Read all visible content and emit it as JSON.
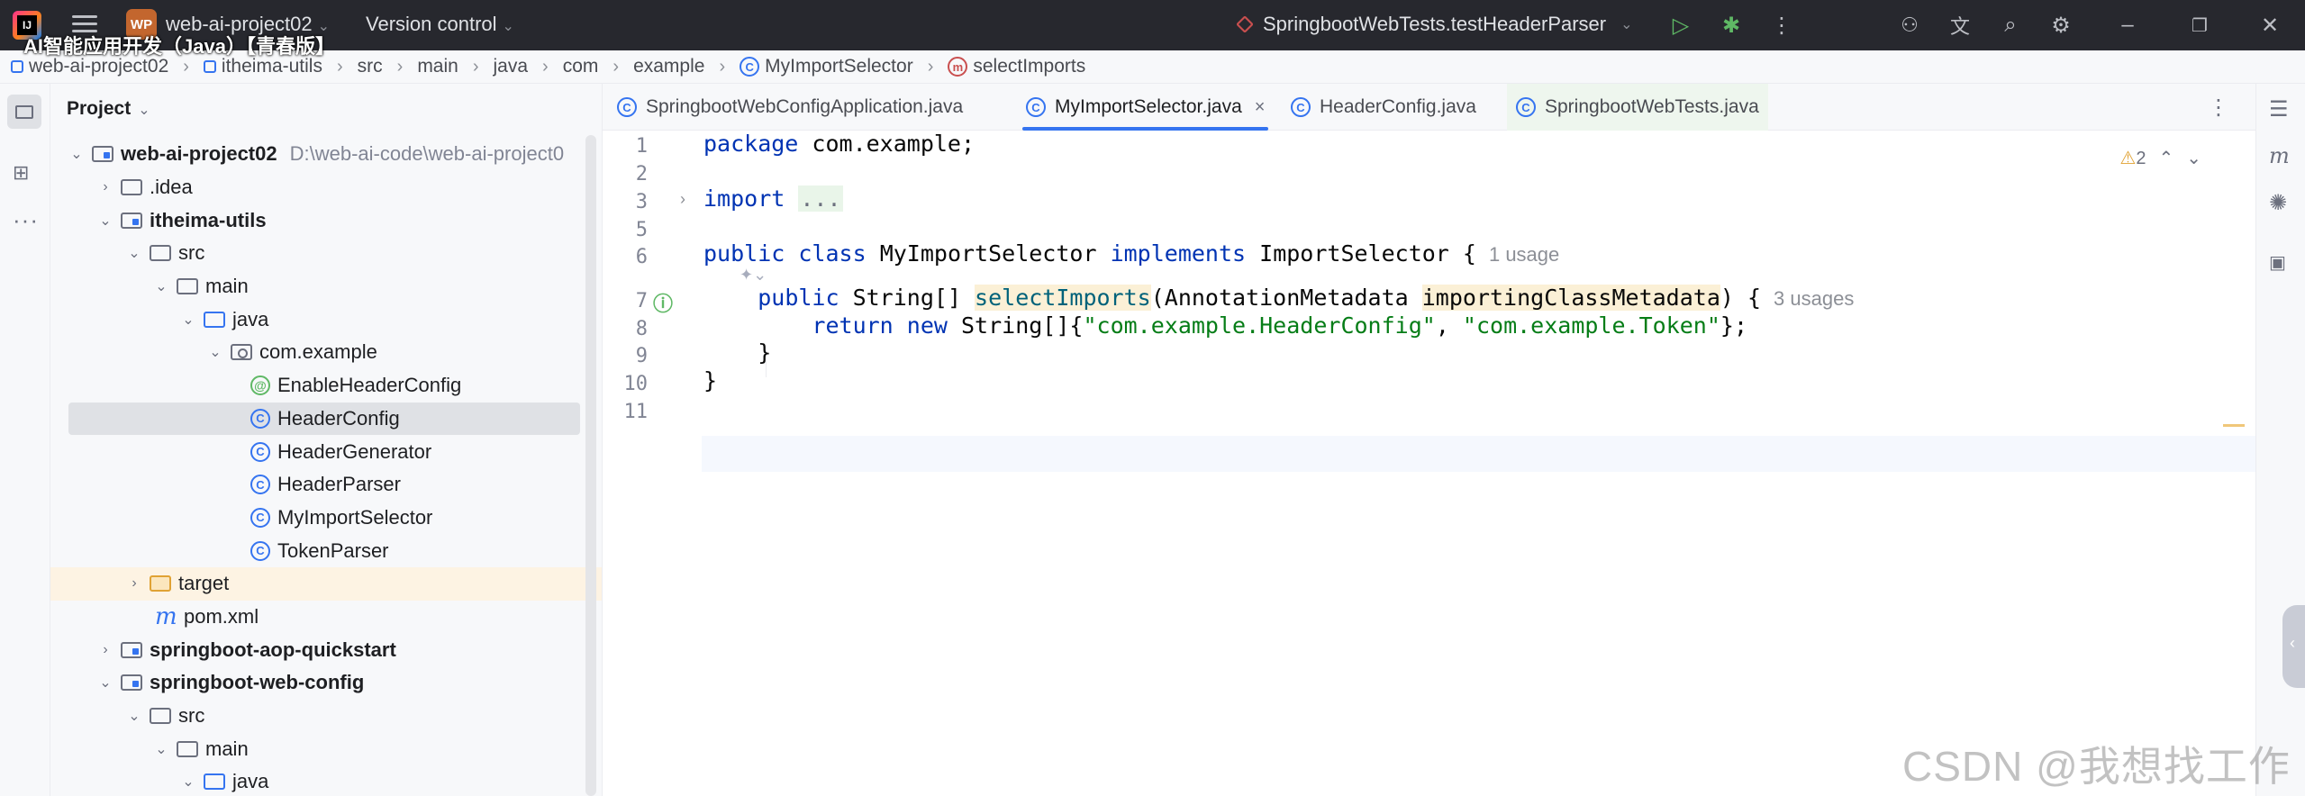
{
  "window": {
    "project_badge": "WP",
    "project_name": "web-ai-project02",
    "version_control": "Version control",
    "run_config": "SpringbootWebTests.testHeaderParser",
    "video_title": "AI智能应用开发（Java）【青春版】"
  },
  "breadcrumb": [
    "web-ai-project02",
    "itheima-utils",
    "src",
    "main",
    "java",
    "com",
    "example",
    "MyImportSelector",
    "selectImports"
  ],
  "project_panel": {
    "title": "Project",
    "root_name": "web-ai-project02",
    "root_path": "D:\\web-ai-code\\web-ai-project0",
    "items": [
      {
        "label": "web-ai-project02"
      },
      {
        "label": ".idea"
      },
      {
        "label": "itheima-utils"
      },
      {
        "label": "src"
      },
      {
        "label": "main"
      },
      {
        "label": "java"
      },
      {
        "label": "com.example"
      },
      {
        "label": "EnableHeaderConfig"
      },
      {
        "label": "HeaderConfig"
      },
      {
        "label": "HeaderGenerator"
      },
      {
        "label": "HeaderParser"
      },
      {
        "label": "MyImportSelector"
      },
      {
        "label": "TokenParser"
      },
      {
        "label": "target"
      },
      {
        "label": "pom.xml"
      },
      {
        "label": "springboot-aop-quickstart"
      },
      {
        "label": "springboot-web-config"
      },
      {
        "label": "src"
      },
      {
        "label": "main"
      },
      {
        "label": "java"
      }
    ]
  },
  "tabs": [
    {
      "label": "SpringbootWebConfigApplication.java"
    },
    {
      "label": "MyImportSelector.java"
    },
    {
      "label": "HeaderConfig.java"
    },
    {
      "label": "SpringbootWebTests.java"
    }
  ],
  "editor": {
    "warning_count": "2",
    "line_numbers": [
      "1",
      "2",
      "3",
      "5",
      "6",
      "7",
      "8",
      "9",
      "10",
      "11"
    ],
    "code": {
      "l1_kw": "package",
      "l1_rest": " com.example;",
      "l3_kw": "import",
      "l3_fold": "...",
      "l6_kw1": "public",
      "l6_kw2": "class",
      "l6_name": " MyImportSelector ",
      "l6_kw3": "implements",
      "l6_rest": " ImportSelector {",
      "l6_hint": "1 usage",
      "l7_kw": "public",
      "l7_type": " String[] ",
      "l7_fn": "selectImports",
      "l7_p1": "(AnnotationMetadata ",
      "l7_param": "importingClassMetadata",
      "l7_p2": ") {",
      "l7_hint": "3 usages",
      "l8_kw1": "return",
      "l8_kw2": "new",
      "l8_mid": " String[]{",
      "l8_s1": "\"com.example.HeaderConfig\"",
      "l8_comma": ", ",
      "l8_s2": "\"com.example.Token\"",
      "l8_end": "};",
      "l9": "}",
      "l10": "}"
    }
  },
  "watermark": "CSDN @我想找工作"
}
